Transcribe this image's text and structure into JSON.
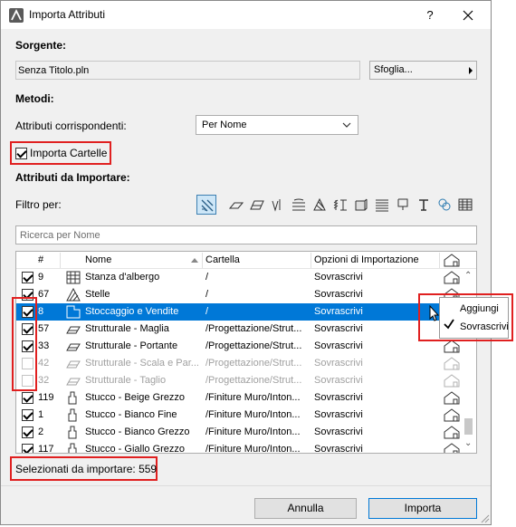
{
  "window": {
    "title": "Importa Attributi",
    "help_label": "?"
  },
  "source": {
    "heading": "Sorgente:",
    "file_name": "Senza Titolo.pln",
    "browse_label": "Sfoglia..."
  },
  "methods": {
    "heading": "Metodi:",
    "match_label": "Attributi corrispondenti:",
    "match_value": "Per Nome",
    "import_folders_label": "Importa Cartelle",
    "import_folders_checked": true
  },
  "attributes": {
    "heading": "Attributi da Importare:",
    "filter_label": "Filtro per:",
    "search_placeholder": "Ricerca per Nome",
    "filter_icons": [
      "all-attributes-icon",
      "line-type-icon",
      "fill-icon",
      "composite-icon",
      "pen-icon",
      "surface-icon",
      "building-material-icon",
      "profile-icon",
      "zone-category-icon",
      "mep-icon",
      "markup-icon",
      "operation-profile-icon",
      "grid-table-icon"
    ]
  },
  "table": {
    "columns": {
      "index": "#",
      "name": "Nome",
      "folder": "Cartella",
      "options": "Opzioni di Importazione"
    },
    "rows": [
      {
        "checked": true,
        "disabled": false,
        "selected": false,
        "num": "9",
        "icon": "zone-grid-icon",
        "name": "Stanza d'albergo",
        "folder": "/",
        "option": "Sovrascrivi"
      },
      {
        "checked": true,
        "disabled": false,
        "selected": false,
        "num": "67",
        "icon": "hatch-fill-icon",
        "name": "Stelle",
        "folder": "/",
        "option": "Sovrascrivi"
      },
      {
        "checked": true,
        "disabled": false,
        "selected": true,
        "num": "8",
        "icon": "zone-plan-icon",
        "name": "Stoccaggio e Vendite",
        "folder": "/",
        "option": "Sovrascrivi"
      },
      {
        "checked": true,
        "disabled": false,
        "selected": false,
        "num": "57",
        "icon": "surface-icon",
        "name": "Strutturale - Maglia",
        "folder": "/Progettazione/Strut...",
        "option": "Sovrascrivi"
      },
      {
        "checked": true,
        "disabled": false,
        "selected": false,
        "num": "33",
        "icon": "surface-icon",
        "name": "Strutturale - Portante",
        "folder": "/Progettazione/Strut...",
        "option": "Sovrascrivi"
      },
      {
        "checked": false,
        "disabled": true,
        "selected": false,
        "num": "42",
        "icon": "surface-icon",
        "name": "Strutturale - Scala e Par...",
        "folder": "/Progettazione/Strut...",
        "option": "Sovrascrivi"
      },
      {
        "checked": false,
        "disabled": true,
        "selected": false,
        "num": "32",
        "icon": "surface-icon",
        "name": "Strutturale - Taglio",
        "folder": "/Progettazione/Strut...",
        "option": "Sovrascrivi"
      },
      {
        "checked": true,
        "disabled": false,
        "selected": false,
        "num": "119",
        "icon": "brush-icon",
        "name": "Stucco - Beige Grezzo",
        "folder": "/Finiture Muro/Inton...",
        "option": "Sovrascrivi"
      },
      {
        "checked": true,
        "disabled": false,
        "selected": false,
        "num": "1",
        "icon": "brush-icon",
        "name": "Stucco - Bianco Fine",
        "folder": "/Finiture Muro/Inton...",
        "option": "Sovrascrivi"
      },
      {
        "checked": true,
        "disabled": false,
        "selected": false,
        "num": "2",
        "icon": "brush-icon",
        "name": "Stucco - Bianco Grezzo",
        "folder": "/Finiture Muro/Inton...",
        "option": "Sovrascrivi"
      },
      {
        "checked": true,
        "disabled": false,
        "selected": false,
        "num": "117",
        "icon": "brush-icon",
        "name": "Stucco - Giallo Grezzo",
        "folder": "/Finiture Muro/Inton...",
        "option": "Sovrascrivi"
      }
    ]
  },
  "popup": {
    "items": [
      {
        "label": "Aggiungi",
        "checked": false
      },
      {
        "label": "Sovrascrivi",
        "checked": true
      }
    ]
  },
  "status": {
    "selected_text": "Selezionati da importare: 559"
  },
  "buttons": {
    "cancel": "Annulla",
    "import": "Importa"
  },
  "colors": {
    "accent": "#0078d7",
    "highlight": "#e02020"
  }
}
